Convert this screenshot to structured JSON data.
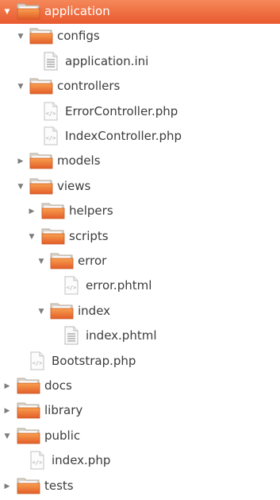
{
  "tree": {
    "items": [
      {
        "label": "application",
        "type": "folder",
        "expanded": true,
        "depth": 0,
        "selected": true
      },
      {
        "label": "configs",
        "type": "folder",
        "expanded": true,
        "depth": 1
      },
      {
        "label": "application.ini",
        "type": "text-file",
        "depth": 2
      },
      {
        "label": "controllers",
        "type": "folder",
        "expanded": true,
        "depth": 1
      },
      {
        "label": "ErrorController.php",
        "type": "code-file",
        "depth": 2
      },
      {
        "label": "IndexController.php",
        "type": "code-file",
        "depth": 2
      },
      {
        "label": "models",
        "type": "folder",
        "expanded": false,
        "depth": 1
      },
      {
        "label": "views",
        "type": "folder",
        "expanded": true,
        "depth": 1
      },
      {
        "label": "helpers",
        "type": "folder",
        "expanded": false,
        "depth": 2
      },
      {
        "label": "scripts",
        "type": "folder",
        "expanded": true,
        "depth": 2
      },
      {
        "label": "error",
        "type": "folder",
        "expanded": true,
        "depth": 3
      },
      {
        "label": "error.phtml",
        "type": "code-file",
        "depth": 4
      },
      {
        "label": "index",
        "type": "folder",
        "expanded": true,
        "depth": 3
      },
      {
        "label": "index.phtml",
        "type": "text-file",
        "depth": 4
      },
      {
        "label": "Bootstrap.php",
        "type": "code-file",
        "depth": 1
      },
      {
        "label": "docs",
        "type": "folder",
        "expanded": false,
        "depth": 0
      },
      {
        "label": "library",
        "type": "folder",
        "expanded": false,
        "depth": 0
      },
      {
        "label": "public",
        "type": "folder",
        "expanded": true,
        "depth": 0
      },
      {
        "label": "index.php",
        "type": "code-file",
        "depth": 1
      },
      {
        "label": "tests",
        "type": "folder",
        "expanded": false,
        "depth": 0
      }
    ]
  },
  "colors": {
    "selection": "#ec6a3c",
    "folder_front": "#f07a3c",
    "folder_back": "#d9d2c8"
  },
  "icons": {
    "folder": "folder-icon",
    "text-file": "text-file-icon",
    "code-file": "code-file-icon",
    "expanded": "triangle-down-icon",
    "collapsed": "triangle-right-icon"
  }
}
